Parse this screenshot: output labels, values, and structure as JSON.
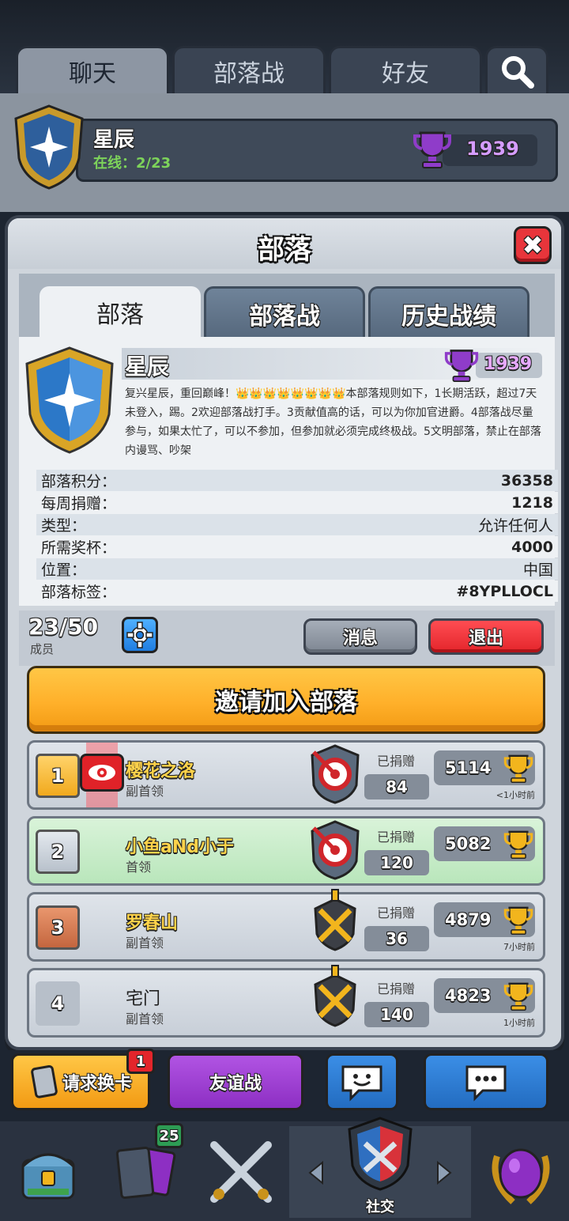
{
  "bg": {
    "tabs": [
      "聊天",
      "部落战",
      "好友"
    ],
    "clan_name": "星辰",
    "online": "在线：2/23",
    "trophies": "1939"
  },
  "modal": {
    "title": "部落",
    "close_glyph": "✖",
    "tabs": [
      "部落",
      "部落战",
      "历史战绩"
    ],
    "clan": {
      "name": "星辰",
      "trophies": "1939",
      "description": "复兴星辰，重回巅峰！👑👑👑👑👑👑👑👑本部落规则如下，1长期活跃，超过7天未登入，踢。2欢迎部落战打手。3贡献值高的话，可以为你加官进爵。4部落战尽量参与，如果太忙了，可以不参加，但参加就必须完成终极战。5文明部落，禁止在部落内谩骂、吵架"
    },
    "stats": [
      {
        "label": "部落积分：",
        "value": "36358"
      },
      {
        "label": "每周捐赠：",
        "value": "1218"
      },
      {
        "label": "类型：",
        "value": "允许任何人"
      },
      {
        "label": "所需奖杯：",
        "value": "4000"
      },
      {
        "label": "位置：",
        "value": "中国"
      },
      {
        "label": "部落标签：",
        "value": "#8YPLLOCL"
      }
    ],
    "members_count": "23/50",
    "members_label": "成员",
    "message_btn": "消息",
    "leave_btn": "退出",
    "invite_btn": "邀请加入部落",
    "donated_label": "已捐赠",
    "members": [
      {
        "rank": "1",
        "name": "樱花之洛",
        "role": "副首领",
        "donated": "84",
        "trophies": "5114",
        "last_seen": "<1小时前"
      },
      {
        "rank": "2",
        "name": "小鱼aNd小于",
        "role": "首领",
        "donated": "120",
        "trophies": "5082",
        "last_seen": ""
      },
      {
        "rank": "3",
        "name": "罗春山",
        "role": "副首领",
        "donated": "36",
        "trophies": "4879",
        "last_seen": "7小时前"
      },
      {
        "rank": "4",
        "name": "宅门",
        "role": "副首领",
        "donated": "140",
        "trophies": "4823",
        "last_seen": "1小时前"
      }
    ]
  },
  "bottom": {
    "request_card": "请求换卡",
    "request_badge": "1",
    "friendly_battle": "友谊战",
    "cards_badge": "25",
    "social_label": "社交"
  },
  "colors": {
    "accent_orange": "#ffb02a",
    "leave_red": "#e3252b",
    "trophy_purple": "#8f3cc9",
    "gold": "#f2b51d"
  }
}
